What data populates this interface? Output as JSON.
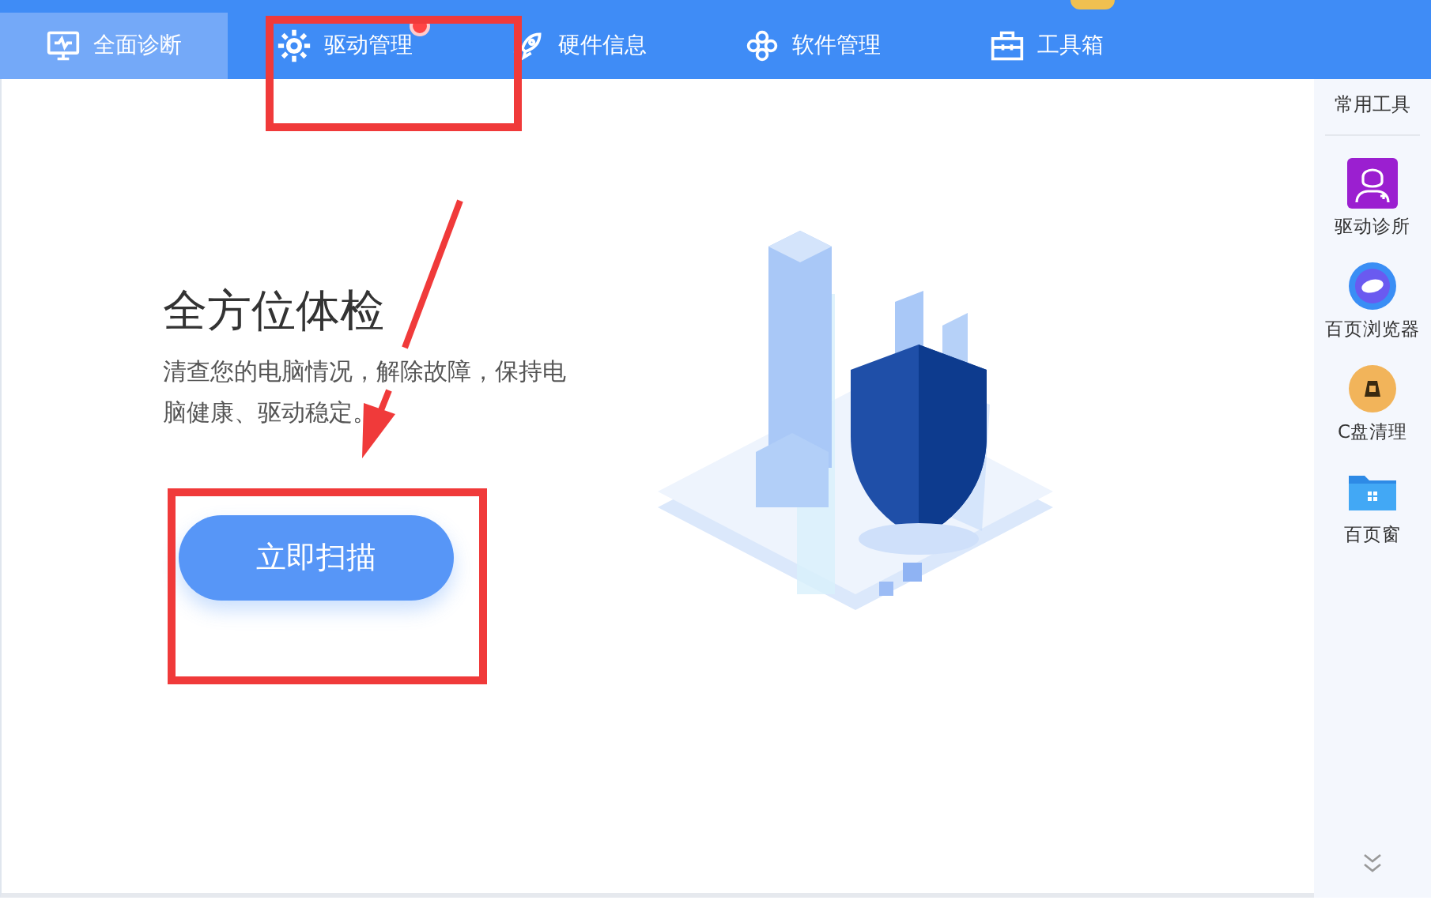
{
  "tabs": [
    {
      "label": "全面诊断",
      "selected": true,
      "badge": false
    },
    {
      "label": "驱动管理",
      "selected": false,
      "badge": true
    },
    {
      "label": "硬件信息",
      "selected": false,
      "badge": false
    },
    {
      "label": "软件管理",
      "selected": false,
      "badge": false
    },
    {
      "label": "工具箱",
      "selected": false,
      "badge": false
    }
  ],
  "hero": {
    "title": "全方位体检",
    "description": "清查您的电脑情况，解除故障，保持电脑健康、驱动稳定。",
    "button": "立即扫描"
  },
  "sidebar": {
    "title": "常用工具",
    "items": [
      {
        "label": "驱动诊所"
      },
      {
        "label": "百页浏览器"
      },
      {
        "label": "C盘清理"
      },
      {
        "label": "百页窗"
      }
    ]
  }
}
